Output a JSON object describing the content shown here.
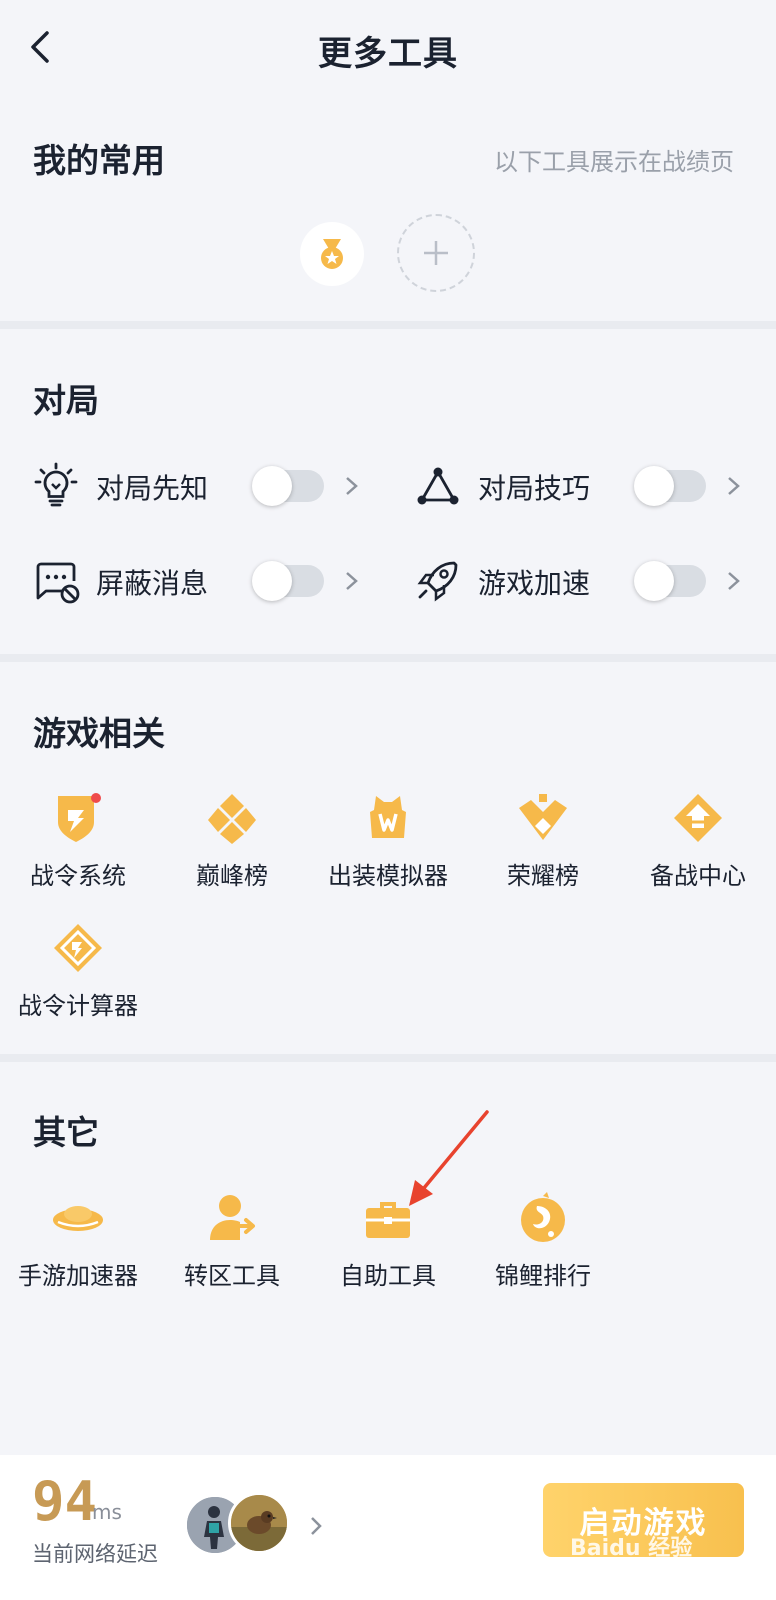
{
  "header": {
    "title": "更多工具"
  },
  "favorites": {
    "title": "我的常用",
    "note": "以下工具展示在战绩页"
  },
  "match": {
    "title": "对局",
    "items": [
      {
        "label": "对局先知",
        "icon": "bulb-icon",
        "on": false
      },
      {
        "label": "对局技巧",
        "icon": "triangle-nodes-icon",
        "on": false
      },
      {
        "label": "屏蔽消息",
        "icon": "block-message-icon",
        "on": false
      },
      {
        "label": "游戏加速",
        "icon": "rocket-icon",
        "on": false
      }
    ]
  },
  "game": {
    "title": "游戏相关",
    "items": [
      {
        "label": "战令系统",
        "icon": "battle-pass-icon",
        "badge": true
      },
      {
        "label": "巅峰榜",
        "icon": "peak-rank-icon"
      },
      {
        "label": "出装模拟器",
        "icon": "equipment-simulator-icon"
      },
      {
        "label": "荣耀榜",
        "icon": "glory-rank-icon"
      },
      {
        "label": "备战中心",
        "icon": "prep-center-icon"
      },
      {
        "label": "战令计算器",
        "icon": "calculator-icon"
      }
    ]
  },
  "other": {
    "title": "其它",
    "items": [
      {
        "label": "手游加速器",
        "icon": "accelerator-icon"
      },
      {
        "label": "转区工具",
        "icon": "transfer-icon"
      },
      {
        "label": "自助工具",
        "icon": "toolbox-icon"
      },
      {
        "label": "锦鲤排行",
        "icon": "koi-icon"
      }
    ]
  },
  "footer": {
    "ping": "94",
    "ping_unit": "ms",
    "ping_label": "当前网络延迟",
    "start_button": "启动游戏",
    "watermark": "Baidu 经验"
  },
  "colors": {
    "accent": "#f6b94a",
    "bg": "#f4f5f9",
    "start_button": "#f8c04e"
  }
}
